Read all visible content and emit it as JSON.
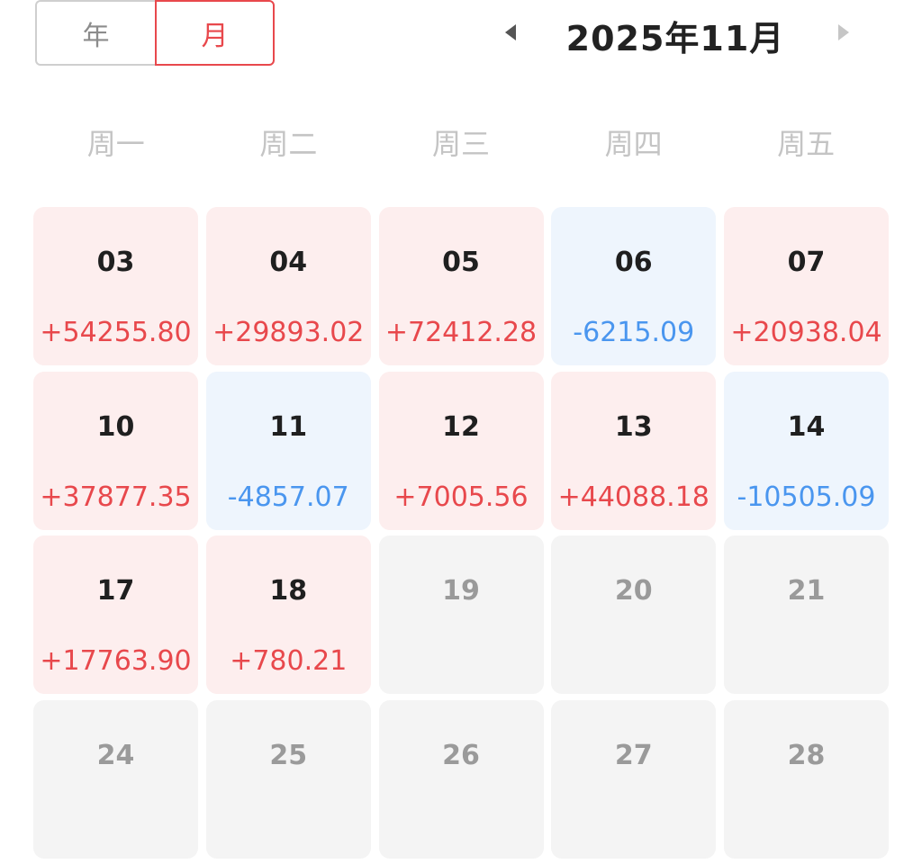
{
  "view_toggle": {
    "year_label": "年",
    "month_label": "月",
    "selected": "month"
  },
  "header": {
    "month_title": "2025年11月"
  },
  "weekdays": [
    "周一",
    "周二",
    "周三",
    "周四",
    "周五"
  ],
  "colors": {
    "positive": "#e8484c",
    "negative": "#4a96ef",
    "accent": "#e8484c"
  },
  "days": [
    {
      "day": "03",
      "value": "+54255.80",
      "sign": "pos"
    },
    {
      "day": "04",
      "value": "+29893.02",
      "sign": "pos"
    },
    {
      "day": "05",
      "value": "+72412.28",
      "sign": "pos"
    },
    {
      "day": "06",
      "value": "-6215.09",
      "sign": "neg"
    },
    {
      "day": "07",
      "value": "+20938.04",
      "sign": "pos"
    },
    {
      "day": "10",
      "value": "+37877.35",
      "sign": "pos"
    },
    {
      "day": "11",
      "value": "-4857.07",
      "sign": "neg"
    },
    {
      "day": "12",
      "value": "+7005.56",
      "sign": "pos"
    },
    {
      "day": "13",
      "value": "+44088.18",
      "sign": "pos"
    },
    {
      "day": "14",
      "value": "-10505.09",
      "sign": "neg"
    },
    {
      "day": "17",
      "value": "+17763.90",
      "sign": "pos"
    },
    {
      "day": "18",
      "value": "+780.21",
      "sign": "pos"
    },
    {
      "day": "19",
      "value": "",
      "sign": "none"
    },
    {
      "day": "20",
      "value": "",
      "sign": "none"
    },
    {
      "day": "21",
      "value": "",
      "sign": "none"
    },
    {
      "day": "24",
      "value": "",
      "sign": "none"
    },
    {
      "day": "25",
      "value": "",
      "sign": "none"
    },
    {
      "day": "26",
      "value": "",
      "sign": "none"
    },
    {
      "day": "27",
      "value": "",
      "sign": "none"
    },
    {
      "day": "28",
      "value": "",
      "sign": "none"
    }
  ]
}
